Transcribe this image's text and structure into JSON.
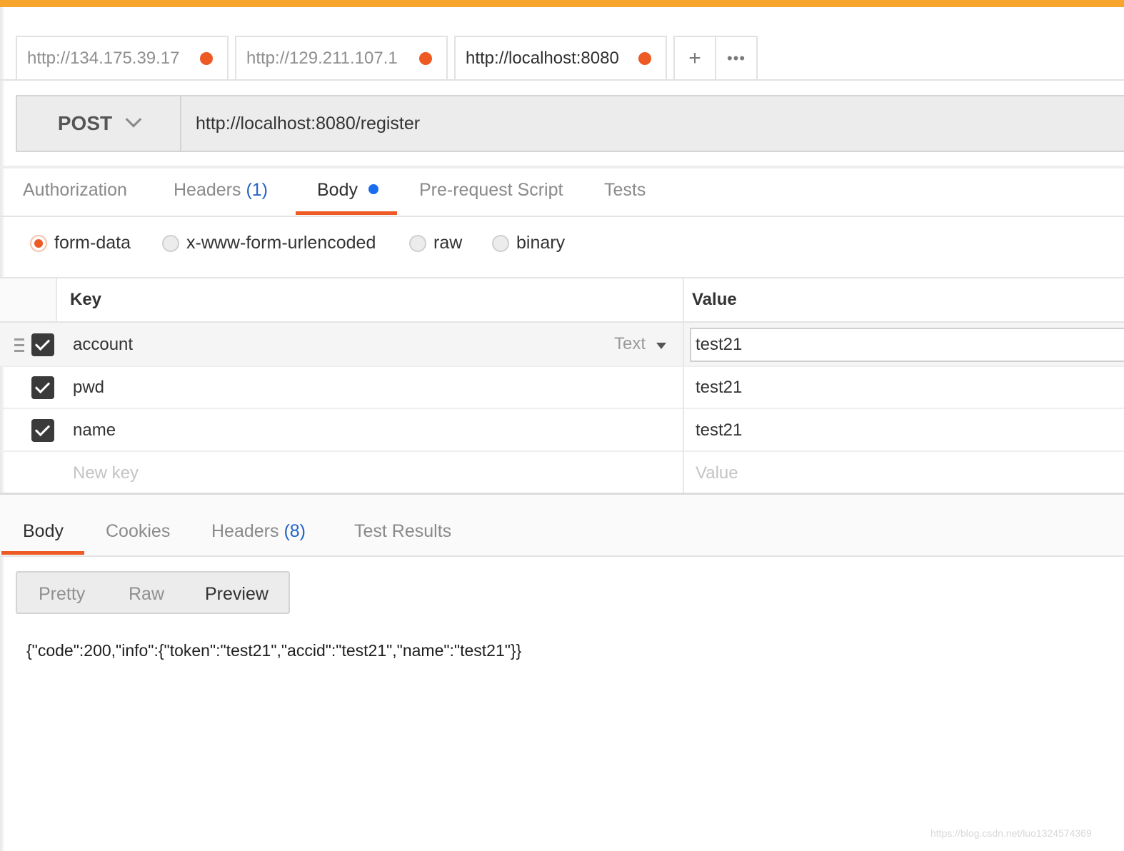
{
  "colors": {
    "accent": "#f8a52d",
    "unsaved_dot": "#ee5a24",
    "active_underline": "#ee5a24",
    "count_blue": "#2563c7",
    "body_dot": "#1a6cf0"
  },
  "tabs": [
    {
      "label": "http://134.175.39.17",
      "unsaved": true,
      "active": false
    },
    {
      "label": "http://129.211.107.1",
      "unsaved": true,
      "active": false
    },
    {
      "label": "http://localhost:8080",
      "unsaved": true,
      "active": true
    }
  ],
  "tab_actions": {
    "add": "+",
    "more": "•••"
  },
  "request": {
    "method": "POST",
    "url": "http://localhost:8080/register"
  },
  "request_tabs": {
    "authorization": "Authorization",
    "headers": "Headers",
    "headers_count": "(1)",
    "body": "Body",
    "prerequest": "Pre-request Script",
    "tests": "Tests",
    "active": "Body"
  },
  "body_modes": {
    "form_data": "form-data",
    "urlencoded": "x-www-form-urlencoded",
    "raw": "raw",
    "binary": "binary",
    "selected": "form-data"
  },
  "table": {
    "key_header": "Key",
    "value_header": "Value",
    "type_label": "Text",
    "rows": [
      {
        "key": "account",
        "value": "test21",
        "checked": true
      },
      {
        "key": "pwd",
        "value": "test21",
        "checked": true
      },
      {
        "key": "name",
        "value": "test21",
        "checked": true
      }
    ],
    "new_key_placeholder": "New key",
    "new_value_placeholder": "Value"
  },
  "response_tabs": {
    "body": "Body",
    "cookies": "Cookies",
    "headers": "Headers",
    "headers_count": "(8)",
    "test_results": "Test Results",
    "active": "Body"
  },
  "view_modes": {
    "pretty": "Pretty",
    "raw": "Raw",
    "preview": "Preview",
    "active": "Preview"
  },
  "response_body": "{\"code\":200,\"info\":{\"token\":\"test21\",\"accid\":\"test21\",\"name\":\"test21\"}}",
  "watermark": "https://blog.csdn.net/luo1324574369"
}
